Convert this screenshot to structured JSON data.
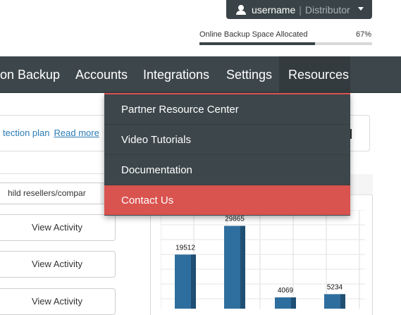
{
  "user": {
    "name": "username",
    "separator": "|",
    "role": "Distributor"
  },
  "backup": {
    "label": "Online Backup Space Allocated",
    "percent_text": "67%",
    "percent": 67
  },
  "nav": {
    "items": [
      {
        "label": "on Backup"
      },
      {
        "label": "Accounts"
      },
      {
        "label": "Integrations"
      },
      {
        "label": "Settings"
      },
      {
        "label": "Resources"
      }
    ]
  },
  "resources_menu": {
    "items": [
      {
        "label": "Partner Resource Center"
      },
      {
        "label": "Video Tutorials"
      },
      {
        "label": "Documentation"
      },
      {
        "label": "Contact Us"
      }
    ]
  },
  "notice": {
    "text": "tection plan",
    "link": "Read more"
  },
  "filter": {
    "placeholder": "hild resellers/compar"
  },
  "activity_buttons": [
    {
      "label": "View Activity"
    },
    {
      "label": "View Activity"
    },
    {
      "label": "View Activity"
    }
  ],
  "colors": {
    "nav_bg": "#3d474b",
    "accent_red": "#d9534f",
    "link_blue": "#2a7bb5",
    "bar_blue": "#2e6e9e"
  },
  "chart_data": {
    "type": "bar",
    "categories": [
      "",
      "",
      "",
      ""
    ],
    "values": [
      19512,
      29865,
      4069,
      5234
    ],
    "data_labels": [
      "19512",
      "29865",
      "4069",
      "5234"
    ],
    "ylim": [
      0,
      30000
    ],
    "grid": true
  }
}
